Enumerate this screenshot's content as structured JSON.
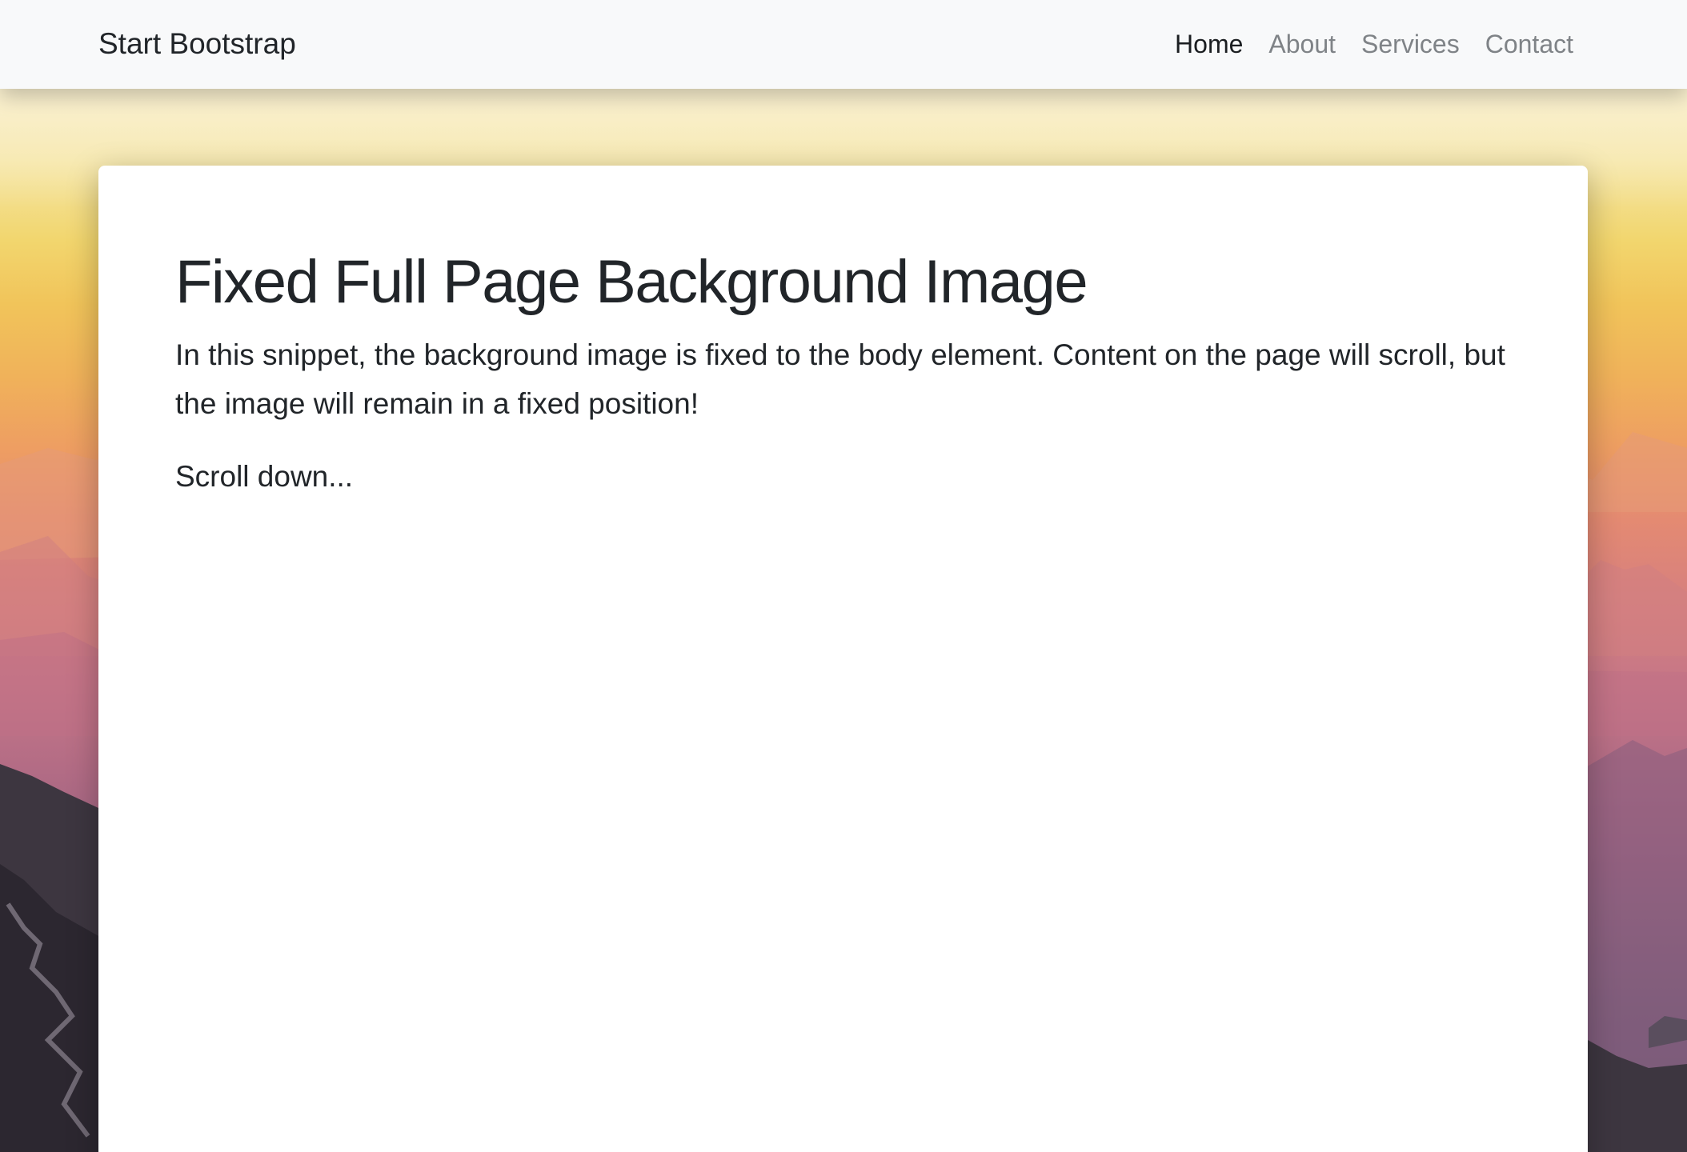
{
  "navbar": {
    "brand": "Start Bootstrap",
    "links": [
      {
        "label": "Home",
        "active": true
      },
      {
        "label": "About",
        "active": false
      },
      {
        "label": "Services",
        "active": false
      },
      {
        "label": "Contact",
        "active": false
      }
    ]
  },
  "main": {
    "title": "Fixed Full Page Background Image",
    "lead": "In this snippet, the background image is fixed to the body element. Content on the page will scroll, but the image will remain in a fixed position!",
    "scroll_hint": "Scroll down..."
  },
  "colors": {
    "navbar_bg": "#f8f9fa",
    "text": "#212529",
    "nav_muted": "#7f8387",
    "card_bg": "#ffffff"
  }
}
